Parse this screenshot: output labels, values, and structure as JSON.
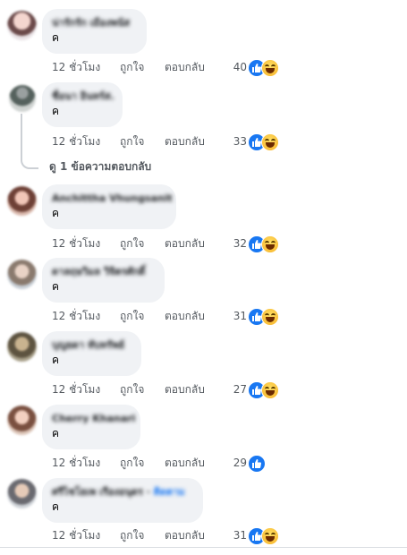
{
  "reactions_colors": {
    "like": "#1877f2",
    "haha": "#f7b125"
  },
  "comments": [
    {
      "author": "น่ารักรัก เมืองพนัส",
      "tag": "",
      "text": "ค",
      "time": "12 ชั่วโมง",
      "like_label": "ถูกใจ",
      "reply_label": "ตอบกลับ",
      "reactions": "40",
      "icons": [
        "like-icon",
        "haha-icon"
      ]
    },
    {
      "author": "ชื่อนา อินทร์ส.",
      "tag": "",
      "text": "ค",
      "time": "12 ชั่วโมง",
      "like_label": "ถูกใจ",
      "reply_label": "ตอบกลับ",
      "reactions": "33",
      "icons": [
        "like-icon",
        "haha-icon"
      ]
    },
    {
      "author": "Anchittha Vhungsanit",
      "tag": "",
      "text": "ค",
      "time": "12 ชั่วโมง",
      "like_label": "ถูกใจ",
      "reply_label": "ตอบกลับ",
      "reactions": "32",
      "icons": [
        "like-icon",
        "haha-icon"
      ]
    },
    {
      "author": "ดาลฤษวิมล วิจิตรศักดิ์",
      "tag": "",
      "text": "ค",
      "time": "12 ชั่วโมง",
      "like_label": "ถูกใจ",
      "reply_label": "ตอบกลับ",
      "reactions": "31",
      "icons": [
        "like-icon",
        "haha-icon"
      ]
    },
    {
      "author": "บุญยดา ทับทรัพย์",
      "tag": "",
      "text": "ค",
      "time": "12 ชั่วโมง",
      "like_label": "ถูกใจ",
      "reply_label": "ตอบกลับ",
      "reactions": "27",
      "icons": [
        "like-icon",
        "haha-icon"
      ]
    },
    {
      "author": "Cherry Khanari",
      "tag": "",
      "text": "ค",
      "time": "12 ชั่วโมง",
      "like_label": "ถูกใจ",
      "reply_label": "ตอบกลับ",
      "reactions": "29",
      "icons": [
        "like-icon"
      ]
    },
    {
      "author": "ศรีไชโยเพ เรืองอนุดร",
      "tag": "ติดตาม",
      "text": "ค",
      "time": "12 ชั่วโมง",
      "like_label": "ถูกใจ",
      "reply_label": "ตอบกลับ",
      "reactions": "31",
      "icons": [
        "like-icon",
        "haha-icon"
      ]
    }
  ],
  "view_replies_label": "ดู 1 ข้อความตอบกลับ"
}
